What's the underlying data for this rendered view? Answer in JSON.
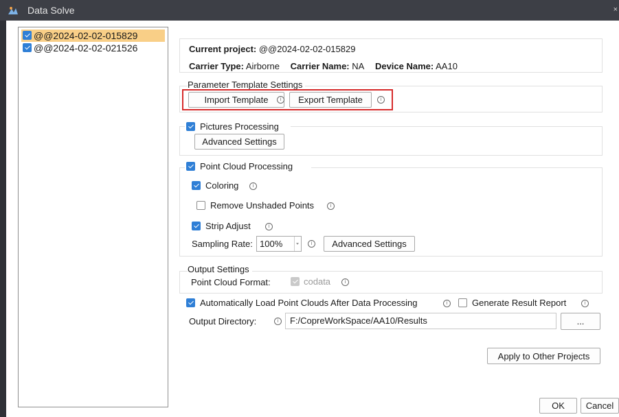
{
  "window": {
    "title": "Data Solve",
    "close_glyph": "×"
  },
  "projects": [
    {
      "name": "@@2024-02-02-015829",
      "checked": true,
      "selected": true
    },
    {
      "name": "@@2024-02-02-021526",
      "checked": true,
      "selected": false
    }
  ],
  "info": {
    "current_project_label": "Current project:",
    "current_project_value": "@@2024-02-02-015829",
    "carrier_type_label": "Carrier Type:",
    "carrier_type_value": "Airborne",
    "carrier_name_label": "Carrier Name:",
    "carrier_name_value": "NA",
    "device_name_label": "Device Name:",
    "device_name_value": "AA10"
  },
  "template": {
    "title": "Parameter Template Settings",
    "import_label": "Import Template",
    "export_label": "Export Template"
  },
  "pictures": {
    "title": "Pictures Processing",
    "checked": true,
    "advanced_label": "Advanced Settings"
  },
  "point_cloud": {
    "title": "Point Cloud Processing",
    "checked": true,
    "coloring_label": "Coloring",
    "coloring_checked": true,
    "remove_unshaded_label": "Remove Unshaded Points",
    "remove_unshaded_checked": false,
    "strip_adjust_label": "Strip Adjust",
    "strip_adjust_checked": true,
    "sampling_rate_label": "Sampling Rate:",
    "sampling_rate_value": "100%",
    "advanced_label": "Advanced Settings"
  },
  "output": {
    "title": "Output Settings",
    "format_label": "Point Cloud Format:",
    "format_value": "codata",
    "auto_load_label": "Automatically Load Point Clouds After Data Processing",
    "auto_load_checked": true,
    "report_label": "Generate Result Report",
    "report_checked": false,
    "directory_label": "Output Directory:",
    "directory_value": "F:/CopreWorkSpace/AA10/Results",
    "browse_label": "..."
  },
  "actions": {
    "apply_label": "Apply to Other Projects",
    "ok_label": "OK",
    "cancel_label": "Cancel"
  },
  "info_icon_glyph": "i",
  "colors": {
    "accent": "#2f7fd6",
    "selection": "#f9cf87",
    "highlight": "#d62a2a",
    "titlebar": "#3d3f46"
  }
}
